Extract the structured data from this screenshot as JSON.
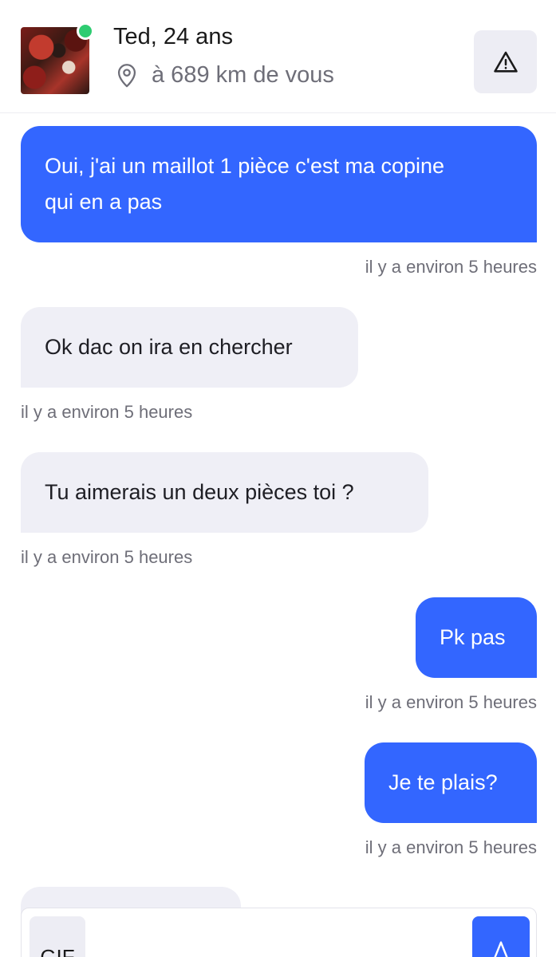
{
  "header": {
    "name_age": "Ted, 24 ans",
    "distance": "à 689 km de vous",
    "online": true,
    "avatar_icon": "profile-photo",
    "location_icon": "map-pin-icon",
    "report_icon": "warning-triangle-icon"
  },
  "messages": [
    {
      "side": "sent",
      "lines": [
        "Oui, j'ai un maillot 1 pièce c'est ma copine",
        "qui en a pas"
      ],
      "time": "il y a environ 5 heures"
    },
    {
      "side": "received",
      "lines": [
        "Ok dac on ira en chercher"
      ],
      "time": "il y a environ 5 heures"
    },
    {
      "side": "received",
      "lines": [
        "Tu aimerais un deux pièces toi ?"
      ],
      "time": "il y a environ 5 heures"
    },
    {
      "side": "sent",
      "lines": [
        "Pk pas"
      ],
      "time": "il y a environ 5 heures"
    },
    {
      "side": "sent",
      "lines": [
        "Je te plais?"
      ],
      "time": "il y a environ 5 heures"
    }
  ],
  "composer": {
    "gif_label": "GIF",
    "send_icon": "send-icon"
  },
  "colors": {
    "accent": "#3366ff",
    "received_bubble": "#efeff6",
    "online": "#2ecc71",
    "muted_text": "#6e6e78"
  }
}
